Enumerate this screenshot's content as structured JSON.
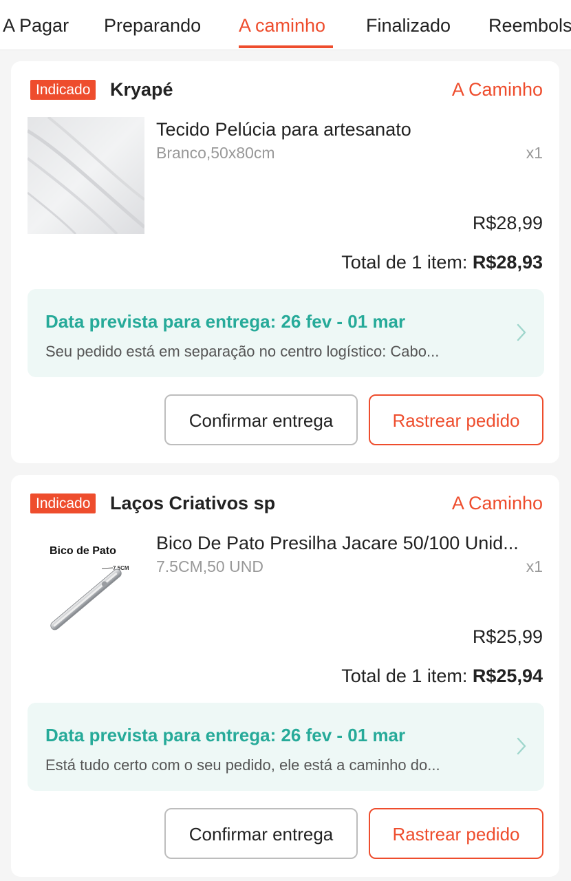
{
  "tabs": [
    {
      "label": "A Pagar",
      "active": false
    },
    {
      "label": "Preparando",
      "active": false
    },
    {
      "label": "A caminho",
      "active": true
    },
    {
      "label": "Finalizado",
      "active": false
    },
    {
      "label": "Reembolsos",
      "active": false
    }
  ],
  "colors": {
    "accent": "#ee4d2d",
    "delivery_text": "#26aa99",
    "delivery_bg": "#eef8f6"
  },
  "orders": [
    {
      "badge": "Indicado",
      "shop_name": "Kryapé",
      "status": "A Caminho",
      "product_name": "Tecido Pelúcia para artesanato",
      "variant": "Branco,50x80cm",
      "quantity": "x1",
      "price": "R$28,99",
      "total_label": "Total de 1 item: ",
      "total_amount": "R$28,93",
      "delivery_title": "Data prevista para entrega: 26 fev - 01 mar",
      "delivery_message": "Seu pedido está em separação no centro logístico: Cabo...",
      "confirm_label": "Confirmar entrega",
      "track_label": "Rastrear pedido",
      "image_icon": "white-fabric-image"
    },
    {
      "badge": "Indicado",
      "shop_name": "Laços Criativos sp",
      "status": "A Caminho",
      "product_name": "Bico De Pato Presilha Jacare 50/100 Unid...",
      "variant": "7.5CM,50 UND",
      "quantity": "x1",
      "price": "R$25,99",
      "total_label": "Total de 1 item: ",
      "total_amount": "R$25,94",
      "delivery_title": "Data prevista para entrega: 26 fev - 01 mar",
      "delivery_message": "Está tudo certo com o seu pedido, ele está a caminho do...",
      "confirm_label": "Confirmar entrega",
      "track_label": "Rastrear pedido",
      "image_icon": "hair-clip-image",
      "image_text": "Bico de Pato",
      "image_size_label": "7,5CM"
    }
  ]
}
